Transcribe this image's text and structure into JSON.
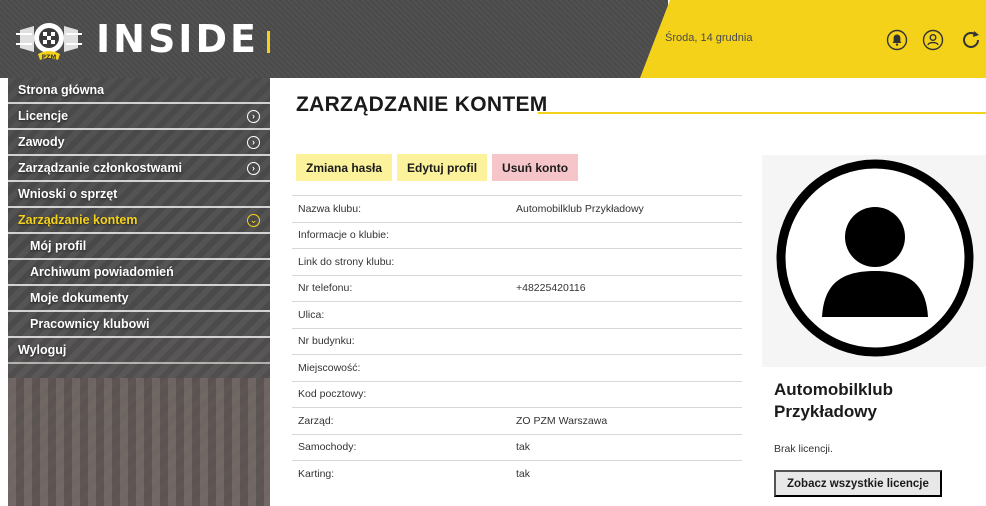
{
  "header": {
    "logo_text": "INSIDE",
    "logo_badge": "PZM",
    "date": "Środa, 14 grudnia",
    "icons": [
      "bell-icon",
      "user-circle-icon",
      "refresh-icon"
    ],
    "accent_color": "#f5d21a"
  },
  "sidebar": {
    "items": [
      {
        "label": "Strona główna",
        "has_chevron": false
      },
      {
        "label": "Licencje",
        "has_chevron": true
      },
      {
        "label": "Zawody",
        "has_chevron": true
      },
      {
        "label": "Zarządzanie członkostwami",
        "has_chevron": true
      },
      {
        "label": "Wnioski o sprzęt",
        "has_chevron": false
      },
      {
        "label": "Zarządzanie kontem",
        "has_chevron": true,
        "active": true,
        "expanded": true
      },
      {
        "label": "Mój profil",
        "sub": true
      },
      {
        "label": "Archiwum powiadomień",
        "sub": true
      },
      {
        "label": "Moje dokumenty",
        "sub": true
      },
      {
        "label": "Pracownicy klubowi",
        "sub": true
      },
      {
        "label": "Wyloguj",
        "has_chevron": false
      }
    ]
  },
  "main": {
    "title": "ZARZĄDZANIE KONTEM",
    "actions": {
      "change_password": "Zmiana hasła",
      "edit_profile": "Edytuj profil",
      "delete_account": "Usuń konto"
    },
    "fields": [
      {
        "label": "Nazwa klubu:",
        "value": "Automobilklub Przykładowy"
      },
      {
        "label": "Informacje o klubie:",
        "value": ""
      },
      {
        "label": "Link do strony klubu:",
        "value": ""
      },
      {
        "label": "Nr telefonu:",
        "value": "+48225420116"
      },
      {
        "label": "Ulica:",
        "value": ""
      },
      {
        "label": "Nr budynku:",
        "value": ""
      },
      {
        "label": "Miejscowość:",
        "value": ""
      },
      {
        "label": "Kod pocztowy:",
        "value": ""
      },
      {
        "label": "Zarząd:",
        "value": "ZO PZM Warszawa"
      },
      {
        "label": "Samochody:",
        "value": "tak"
      },
      {
        "label": "Karting:",
        "value": "tak"
      }
    ]
  },
  "profile": {
    "avatar_icon": "user-avatar-icon",
    "club_name_line1": "Automobilklub",
    "club_name_line2": "Przykładowy",
    "license_status": "Brak licencji.",
    "all_licenses_button": "Zobacz wszystkie licencje"
  }
}
